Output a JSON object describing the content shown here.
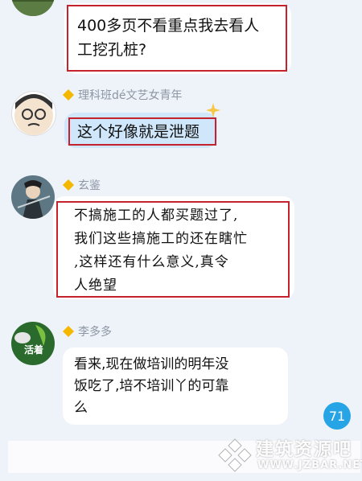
{
  "messages": [
    {
      "text": "400多页不看重点我去看人\n工挖孔桩?"
    },
    {
      "sender": "理科班dé文艺女青年",
      "text": "这个好像就是泄题"
    },
    {
      "sender": "玄鉴",
      "text": "不搞施工的人都买题过了,\n我们这些搞施工的还在瞎忙\n,这样还有什么意义,真令\n人绝望"
    },
    {
      "sender": "李多多",
      "avatar_text": "活着",
      "text": "看来,现在做培训的明年没\n饭吃了,培不培训丫的可靠\n么"
    }
  ],
  "unread_badge": "71",
  "watermark": {
    "title": "建筑资源吧",
    "url": "WWW.JZBAR.NET"
  },
  "colors": {
    "background": "#eef2f9",
    "highlight_box": "#c4232e",
    "badge": "#27a4e6"
  }
}
